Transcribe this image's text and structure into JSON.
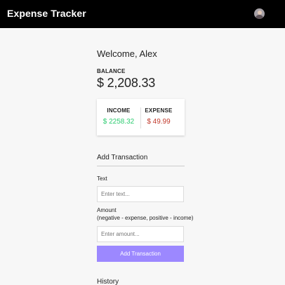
{
  "header": {
    "title": "Expense Tracker",
    "avatar_icon": "user-avatar"
  },
  "welcome": "Welcome, Alex",
  "balance": {
    "label": "BALANCE",
    "value": "$ 2,208.33"
  },
  "summary": {
    "income_label": "INCOME",
    "income_value": "$ 2258.32",
    "income_color": "#2ecc71",
    "expense_label": "EXPENSE",
    "expense_value": "$ 49.99",
    "expense_color": "#c0392b"
  },
  "form": {
    "title": "Add Transaction",
    "text_label": "Text",
    "text_placeholder": "Enter text...",
    "amount_label": "Amount",
    "amount_hint": "(negative - expense, positive - income)",
    "amount_placeholder": "Enter amount...",
    "submit_label": "Add Transaction",
    "submit_color": "#9c88ff"
  },
  "history": {
    "title": "History"
  }
}
